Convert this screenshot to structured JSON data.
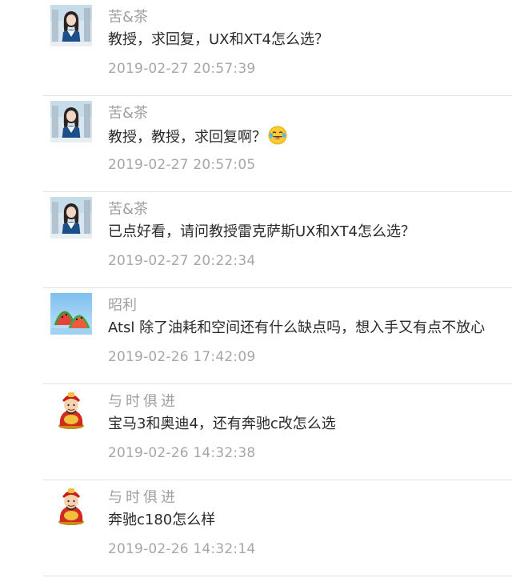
{
  "comments": [
    {
      "nickname": "苦&茶",
      "content": "教授，求回复，UX和XT4怎么选？",
      "time": "2019-02-27 20:57:39",
      "avatar": "girl-photo-avatar"
    },
    {
      "nickname": "苦&茶",
      "content": "教授，教授，求回复啊？",
      "emoji": "laughing-tears-emoji",
      "time": "2019-02-27 20:57:05",
      "avatar": "girl-photo-avatar"
    },
    {
      "nickname": "苦&茶",
      "content": "已点好看，请问教授雷克萨斯UX和XT4怎么选？",
      "time": "2019-02-27 20:22:34",
      "avatar": "girl-photo-avatar"
    },
    {
      "nickname": "昭利",
      "content": "Atsl 除了油耗和空间还有什么缺点吗，想入手又有点不放心",
      "time": "2019-02-26 17:42:09",
      "avatar": "watermelon-avatar"
    },
    {
      "nickname": "与时俱进",
      "content": "宝马3和奥迪4，还有奔驰c改怎么选",
      "time": "2019-02-26 14:32:38",
      "avatar": "fortune-god-avatar"
    },
    {
      "nickname": "与时俱进",
      "content": "奔驰c180怎么样",
      "time": "2019-02-26 14:32:14",
      "avatar": "fortune-god-avatar"
    }
  ]
}
